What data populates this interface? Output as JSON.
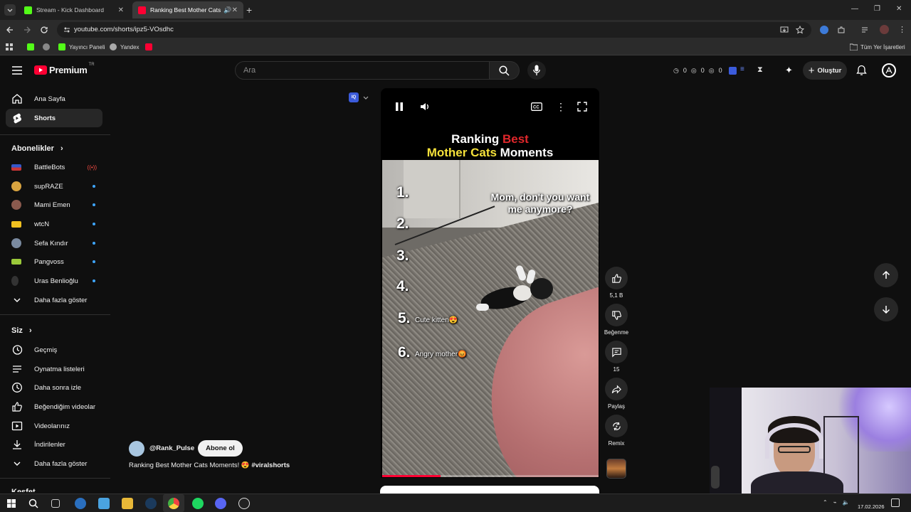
{
  "browser": {
    "tabs": [
      {
        "title": "Stream - Kick Dashboard",
        "active": false
      },
      {
        "title": "Ranking Best Mother Cats Mo",
        "active": true
      }
    ],
    "url": "youtube.com/shorts/ipz5-VOsdhc",
    "bookmarks": [
      "Yayıncı Paneli",
      "Yandex"
    ],
    "all_bookmarks_label": "Tüm Yer İşaretleri"
  },
  "masthead": {
    "logo_text": "Premium",
    "logo_region": "TR",
    "search_placeholder": "Ara",
    "counters": [
      "0",
      "0",
      "0"
    ],
    "create_label": "Oluştur"
  },
  "sidebar": {
    "home": "Ana Sayfa",
    "shorts": "Shorts",
    "subs_title": "Abonelikler",
    "subscriptions": [
      "BattleBots",
      "supRAZE",
      "Mami Emen",
      "wtcN",
      "Sefa Kındır",
      "Pangvoss",
      "Uras Benlioğlu"
    ],
    "show_more": "Daha fazla göster",
    "you_title": "Siz",
    "you_items": [
      "Geçmiş",
      "Oynatma listeleri",
      "Daha sonra izle",
      "Beğendiğim videolar",
      "Videolarınız",
      "İndirilenler"
    ],
    "show_more_2": "Daha fazla göster",
    "explore_title": "Keşfet"
  },
  "video": {
    "title_line1_white": "Ranking",
    "title_line1_red": "Best",
    "title_line2_yellow": "Mother Cats",
    "title_line2_white": "Moments",
    "caption": "Mom, don't you want me anymore?",
    "ranks": [
      "1.",
      "2.",
      "3.",
      "4.",
      "5.",
      "6."
    ],
    "rank5_note": "Cute kitten😍",
    "rank6_note": "Angry mother😡",
    "progress": 0.27
  },
  "channel": {
    "handle": "@Rank_Pulse",
    "subscribe_label": "Abone ol",
    "description": "Ranking Best Mother Cats Moments! 😍",
    "hashtag": "#viralshorts"
  },
  "actions": {
    "like_count": "5,1 B",
    "dislike_label": "Beğenme",
    "comment_count": "15",
    "share_label": "Paylaş",
    "remix_label": "Remix"
  },
  "taskbar": {
    "time": "17.02.2026"
  },
  "colors": {
    "accent_red": "#ff0033",
    "title_yellow": "#f5e13a",
    "title_red": "#e0272b",
    "link_blue": "#3ea6ff"
  }
}
